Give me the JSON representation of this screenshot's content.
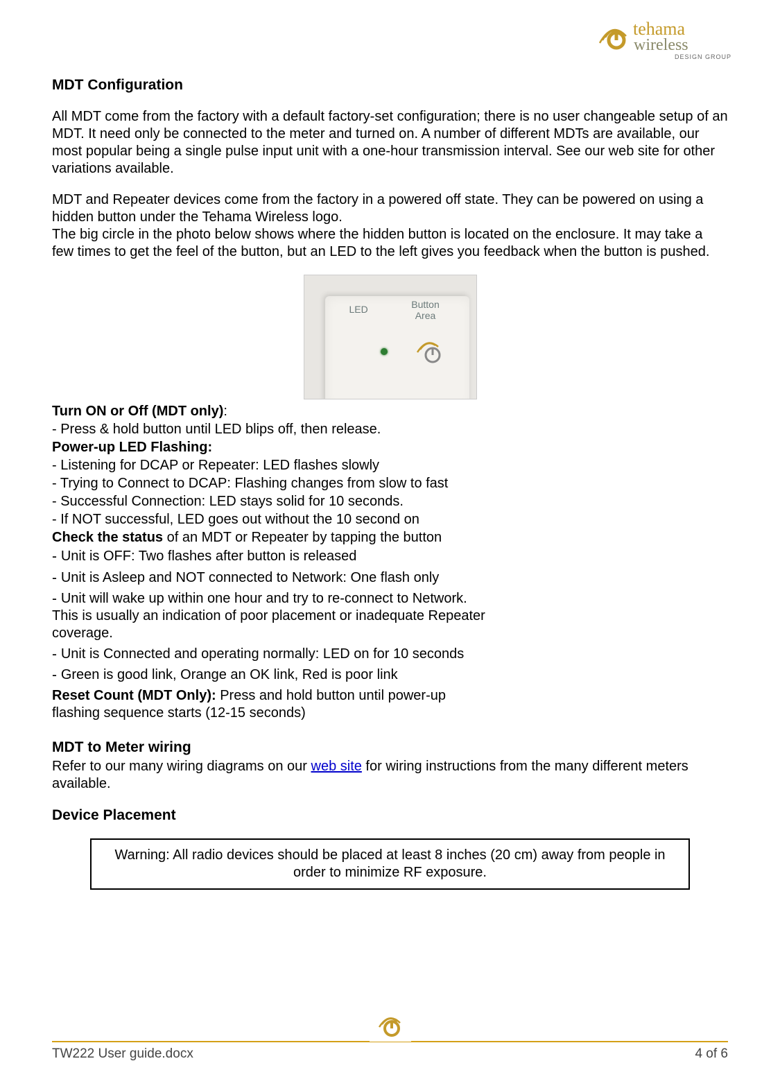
{
  "logo": {
    "line1": "tehama",
    "line2": "wireless",
    "tag": "DESIGN GROUP"
  },
  "s1": {
    "heading": "MDT Configuration",
    "p1": "All MDT come from the factory with a default factory-set configuration; there is no user changeable setup of an MDT.  It need only be connected to the meter and turned on.  A number of different MDTs are available, our most popular being a single pulse input unit with a one-hour transmission interval.  See our web site for other variations available.",
    "p2a": "MDT and Repeater devices come from the factory in a powered off state.  They can be powered on using a hidden button under the Tehama Wireless logo.",
    "p2b": "The big circle in the photo below shows where the hidden button is located on the enclosure.  It may take a few times to get the feel of the button, but an LED to the left gives you feedback when the button is pushed."
  },
  "photo": {
    "led": "LED",
    "btn": "Button Area"
  },
  "inst": {
    "h1a": "Turn ON or Off (MDT only)",
    "h1b": ":",
    "l1": "- Press & hold button until LED blips off, then release.",
    "h2": "Power-up LED Flashing:",
    "l2": "- Listening for DCAP or Repeater: LED flashes slowly",
    "l3": "- Trying to Connect to DCAP: Flashing changes from slow to fast",
    "l4": "- Successful Connection: LED stays solid for 10 seconds.",
    "l5": "- If NOT successful, LED goes out without the 10 second on",
    "h3": "Check the status",
    "h3b": " of an MDT or Repeater by tapping the button",
    "d1": "Unit is OFF: Two flashes after button is released",
    "d2": "Unit is Asleep and NOT connected to Network: One flash only",
    "d3": "Unit will wake up within one hour and try to re-connect to Network. This is usually an indication of poor placement or inadequate Repeater coverage.",
    "d4": "Unit is Connected and operating normally: LED on for 10 seconds",
    "d5": "Green is good link, Orange an OK link, Red is poor link",
    "h4": "Reset Count (MDT Only):",
    "h4b": " Press and hold button until power-up flashing sequence starts (12-15 seconds)"
  },
  "s2": {
    "heading": "MDT to Meter wiring",
    "text_a": "Refer to our many wiring diagrams on our ",
    "link": "web site",
    "text_b": " for wiring instructions from the many different meters available."
  },
  "s3": {
    "heading": "Device Placement",
    "warning": "Warning:  All radio devices should be placed at least 8 inches (20 cm) away from people in order to minimize RF exposure."
  },
  "footer": {
    "file": "TW222 User guide.docx",
    "page": "4 of 6"
  }
}
